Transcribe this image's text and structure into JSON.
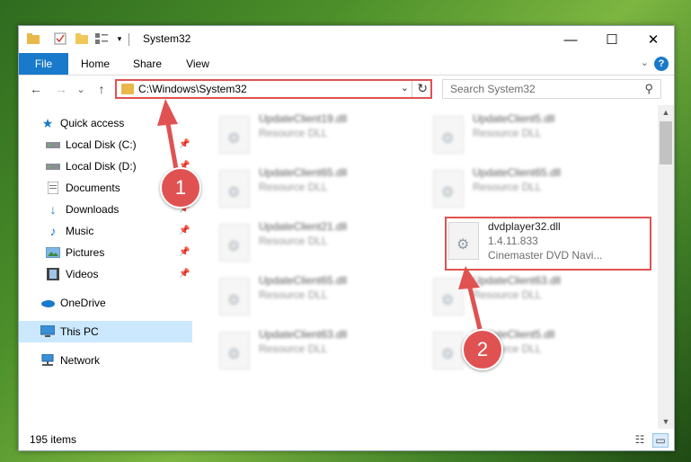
{
  "window": {
    "title": "System32"
  },
  "title_controls": {
    "minimize": "—",
    "maximize": "☐",
    "close": "✕"
  },
  "ribbon": {
    "tabs": [
      "File",
      "Home",
      "Share",
      "View"
    ],
    "help": "?"
  },
  "navigation": {
    "back": "←",
    "forward": "→",
    "recent": "⌄",
    "up": "↑",
    "address": "C:\\Windows\\System32",
    "search_placeholder": "Search System32"
  },
  "sidebar": {
    "items": [
      {
        "label": "Quick access",
        "icon": "star-icon"
      },
      {
        "label": "Local Disk (C:)",
        "icon": "drive-icon",
        "pinned": true
      },
      {
        "label": "Local Disk (D:)",
        "icon": "drive-icon",
        "pinned": true
      },
      {
        "label": "Documents",
        "icon": "documents-icon",
        "pinned": true
      },
      {
        "label": "Downloads",
        "icon": "downloads-icon",
        "pinned": true
      },
      {
        "label": "Music",
        "icon": "music-icon",
        "pinned": true
      },
      {
        "label": "Pictures",
        "icon": "pictures-icon",
        "pinned": true
      },
      {
        "label": "Videos",
        "icon": "videos-icon",
        "pinned": true
      },
      {
        "label": "OneDrive",
        "icon": "cloud-icon"
      },
      {
        "label": "This PC",
        "icon": "computer-icon",
        "selected": true
      },
      {
        "label": "Network",
        "icon": "network-icon"
      }
    ]
  },
  "files": [
    {
      "name": "UpdateClient19.dll",
      "desc": "Resource DLL"
    },
    {
      "name": "UpdateClient5.dll",
      "desc": "Resource DLL"
    },
    {
      "name": "UpdateClient65.dll",
      "desc": "Resource DLL"
    },
    {
      "name": "UpdateClient65.dll",
      "desc": "Resource DLL"
    },
    {
      "name": "UpdateClient21.dll",
      "desc": "Resource DLL"
    },
    {
      "name": "dvdplayer32.dll",
      "desc": "1.4.11.833",
      "extra": "Cinemaster DVD Navi...",
      "highlighted": true
    },
    {
      "name": "UpdateClient65.dll",
      "desc": "Resource DLL"
    },
    {
      "name": "UpdateClient63.dll",
      "desc": "Resource DLL"
    },
    {
      "name": "UpdateClient63.dll",
      "desc": "Resource DLL"
    },
    {
      "name": "UpdateClient5.dll",
      "desc": "Resource DLL"
    }
  ],
  "status": {
    "items": "195 items"
  },
  "annotations": {
    "step1": "1",
    "step2": "2"
  },
  "colors": {
    "accent": "#1979ca",
    "annotation": "#e05252",
    "selected": "#cce8ff"
  }
}
